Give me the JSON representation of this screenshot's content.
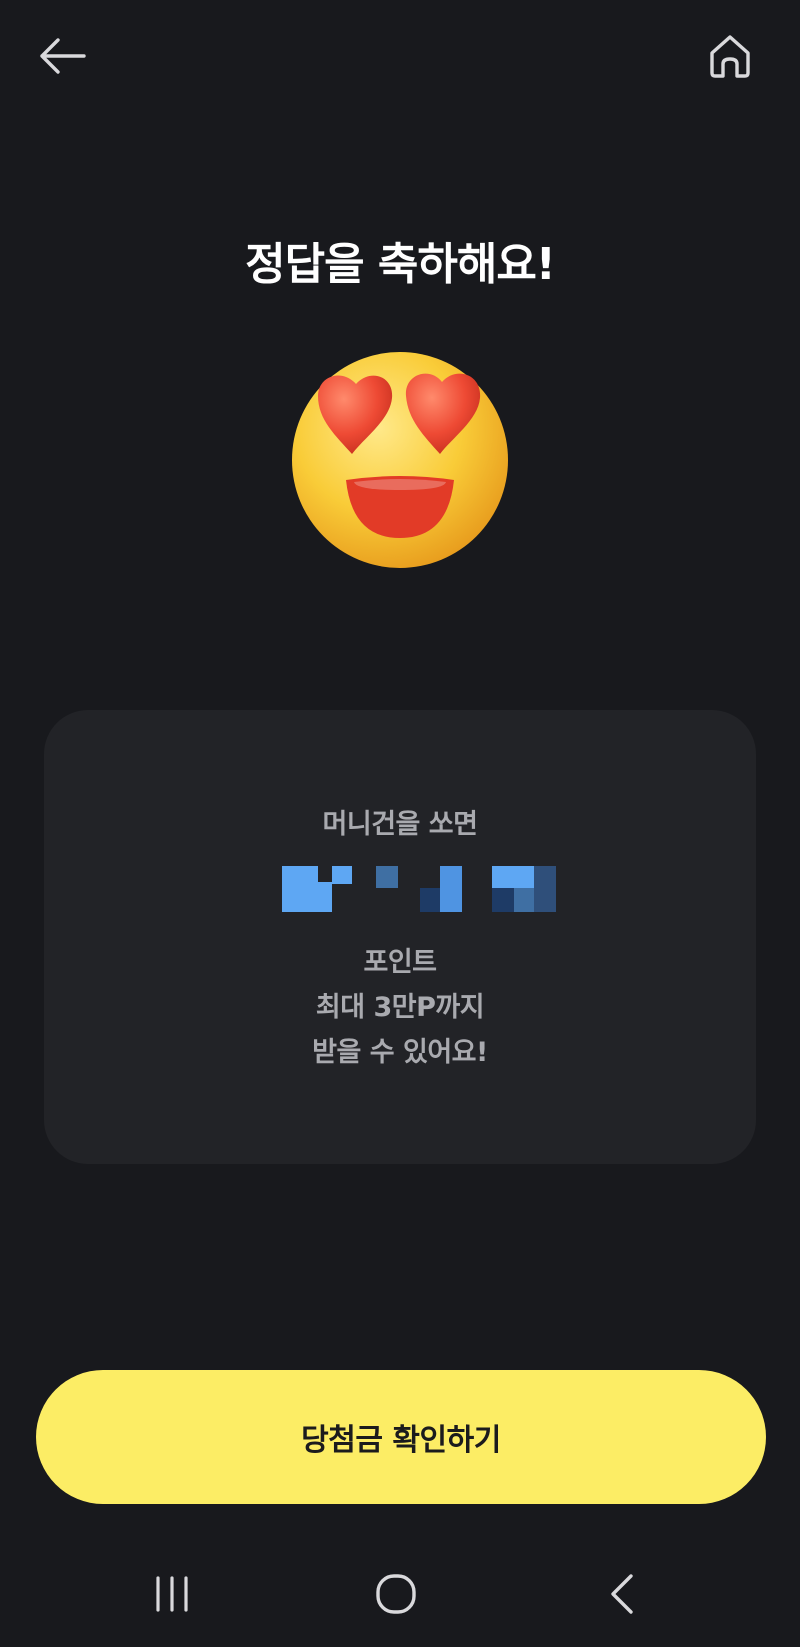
{
  "header": {
    "back_icon": "arrow-left-icon",
    "home_icon": "home-icon"
  },
  "result": {
    "title": "정답을 축하해요!",
    "emoji": "heart-eyes-emoji"
  },
  "card": {
    "line1": "머니건을 쏘면",
    "line2_redacted": true,
    "line3": "포인트",
    "line4": "최대 3만P까지",
    "line5": "받을 수 있어요!"
  },
  "cta": {
    "label": "당첨금 확인하기"
  },
  "system_nav": {
    "recents_icon": "recent-apps-icon",
    "home_icon": "home-circle-icon",
    "back_icon": "chevron-left-icon"
  },
  "colors": {
    "background": "#18191d",
    "card": "#222327",
    "accent_yellow": "#fced65",
    "muted_text": "#a9aaaf",
    "redaction_blue": "#5ea7f3"
  }
}
